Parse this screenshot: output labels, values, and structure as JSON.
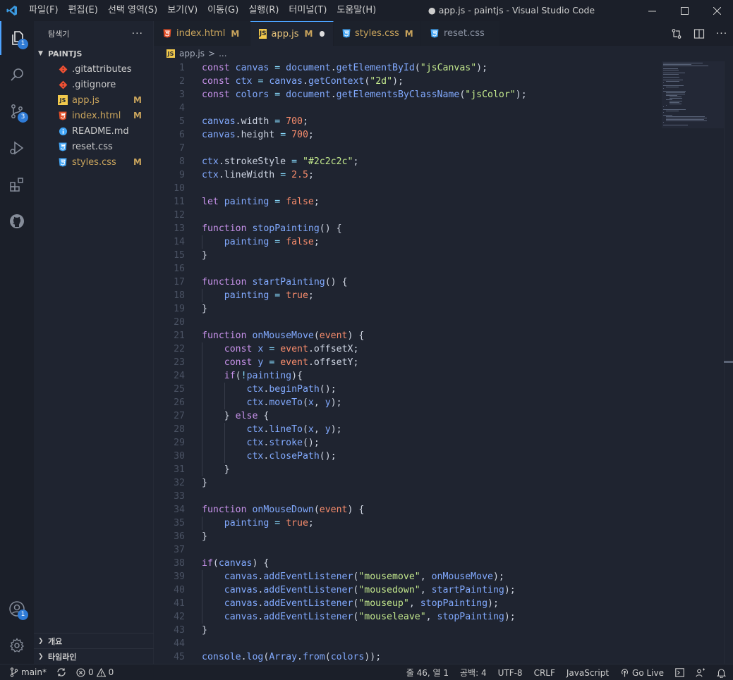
{
  "app": {
    "window_title": "● app.js - paintjs - Visual Studio Code",
    "menu": [
      "파일(F)",
      "편집(E)",
      "선택 영역(S)",
      "보기(V)",
      "이동(G)",
      "실행(R)",
      "터미널(T)",
      "도움말(H)"
    ]
  },
  "activity": {
    "explorer_badge": "1",
    "scm_badge": "3",
    "account_badge": "1"
  },
  "sidebar": {
    "title": "탐색기",
    "more": "···",
    "folder": "PAINTJS",
    "files": [
      {
        "name": ".gitattributes",
        "mod": "",
        "type": "git"
      },
      {
        "name": ".gitignore",
        "mod": "",
        "type": "git"
      },
      {
        "name": "app.js",
        "mod": "M",
        "type": "js"
      },
      {
        "name": "index.html",
        "mod": "M",
        "type": "html"
      },
      {
        "name": "README.md",
        "mod": "",
        "type": "info"
      },
      {
        "name": "reset.css",
        "mod": "",
        "type": "css"
      },
      {
        "name": "styles.css",
        "mod": "M",
        "type": "css"
      }
    ],
    "outline": "개요",
    "timeline": "타임라인"
  },
  "tabs": [
    {
      "name": "index.html",
      "mod": "M"
    },
    {
      "name": "app.js",
      "mod": "M"
    },
    {
      "name": "styles.css",
      "mod": "M"
    },
    {
      "name": "reset.css",
      "mod": ""
    }
  ],
  "breadcrumb": {
    "file": "app.js",
    "sep": ">",
    "rest": "..."
  },
  "code": [
    "const canvas = document.getElementById(\"jsCanvas\");",
    "const ctx = canvas.getContext(\"2d\");",
    "const colors = document.getElementsByClassName(\"jsColor\");",
    "",
    "canvas.width = 700;",
    "canvas.height = 700;",
    "",
    "ctx.strokeStyle = \"#2c2c2c\";",
    "ctx.lineWidth = 2.5;",
    "",
    "let painting = false;",
    "",
    "function stopPainting() {",
    "    painting = false;",
    "}",
    "",
    "function startPainting() {",
    "    painting = true;",
    "}",
    "",
    "function onMouseMove(event) {",
    "    const x = event.offsetX;",
    "    const y = event.offsetY;",
    "    if(!painting){",
    "        ctx.beginPath();",
    "        ctx.moveTo(x, y);",
    "    } else {",
    "        ctx.lineTo(x, y);",
    "        ctx.stroke();",
    "        ctx.closePath();",
    "    }",
    "}",
    "",
    "function onMouseDown(event) {",
    "    painting = true;",
    "}",
    "",
    "if(canvas) {",
    "    canvas.addEventListener(\"mousemove\", onMouseMove);",
    "    canvas.addEventListener(\"mousedown\", startPainting);",
    "    canvas.addEventListener(\"mouseup\", stopPainting);",
    "    canvas.addEventListener(\"mouseleave\", stopPainting);",
    "}",
    "",
    "console.log(Array.from(colors));"
  ],
  "status": {
    "branch": "main*",
    "errors": "0",
    "warnings": "0",
    "position": "줄 46, 열 1",
    "spaces": "공백: 4",
    "encoding": "UTF-8",
    "eol": "CRLF",
    "language": "JavaScript",
    "golive": "Go Live"
  },
  "colors": {
    "accent": "#4da3ff",
    "modified": "#c9a45c",
    "html": "#e44d26",
    "css": "#42a5f5",
    "js": "#f2c94c",
    "git": "#f05133"
  }
}
